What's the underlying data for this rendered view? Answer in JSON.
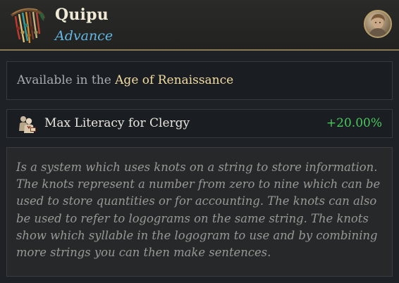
{
  "header": {
    "title": "Quipu",
    "subtitle": "Advance",
    "icon": "quipu-knotted-strings-icon",
    "portrait": "advisor-portrait"
  },
  "availability": {
    "prefix": "Available in the ",
    "age_name": "Age of Renaissance"
  },
  "effect": {
    "icon": "clergy-icon",
    "label": "Max Literacy for Clergy",
    "value": "+20.00%"
  },
  "description": {
    "text": "Is a system which uses knots on a string to store information. The knots represent a number from zero to nine which can be used to store quantities or for accounting. The knots can also be used to refer to logograms on the same string. The knots show which syllable in the logogram to use and by combining more strings you can then make sentences."
  },
  "colors": {
    "title": "#f0e9d6",
    "subtitle": "#62b8e3",
    "age_highlight": "#f2dca0",
    "positive_value": "#49c75a",
    "header_border": "#8a7a52"
  }
}
